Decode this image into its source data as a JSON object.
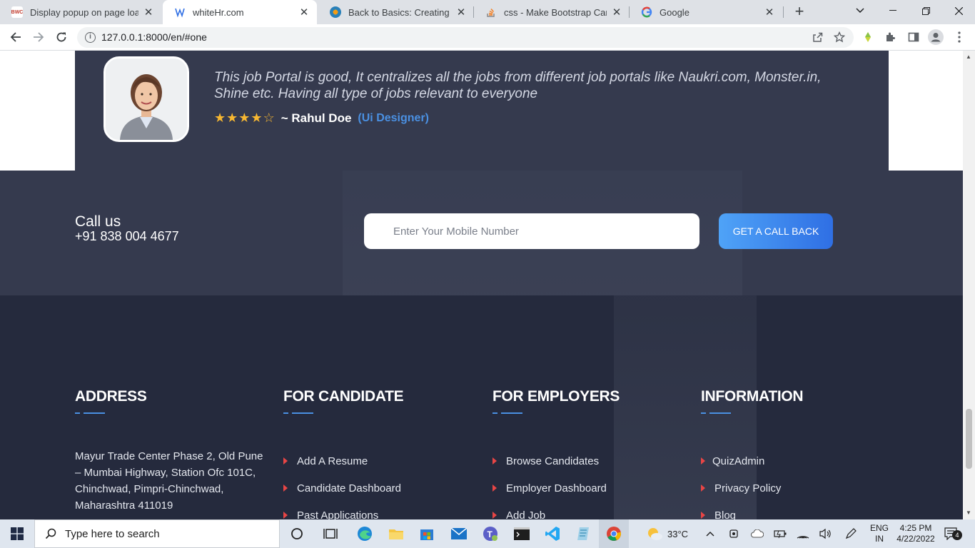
{
  "browser": {
    "tabs": [
      {
        "title": "Display popup on page load",
        "favicon": "bwc-favicon"
      },
      {
        "title": "whiteHr.com",
        "favicon": "whitehr-favicon"
      },
      {
        "title": "Back to Basics: Creating a clic",
        "favicon": "basics-favicon"
      },
      {
        "title": "css - Make Bootstrap Card En",
        "favicon": "stackoverflow-favicon"
      },
      {
        "title": "Google",
        "favicon": "google-favicon"
      }
    ],
    "active_tab": 1,
    "url": "127.0.0.1:8000/en/#one"
  },
  "testimonial": {
    "quote": "This job Portal is good, It centralizes all the jobs from different job portals like Naukri.com, Monster.in, Shine etc. Having all type of jobs relevant to everyone",
    "rating": 4,
    "rating_max": 5,
    "reviewer": "~ Rahul Doe",
    "role": "(Ui Designer)"
  },
  "callband": {
    "title": "Call us",
    "phone": "+91 838 004 4677",
    "input_placeholder": "Enter Your Mobile Number",
    "button_label": "GET A CALL BACK"
  },
  "footer": {
    "address": {
      "heading": "ADDRESS",
      "text": "Mayur Trade Center Phase 2, Old Pune – Mumbai Highway, Station Ofc 101C, Chinchwad, Pimpri-Chinchwad, Maharashtra 411019"
    },
    "candidate": {
      "heading": "FOR CANDIDATE",
      "links": [
        "Add A Resume",
        "Candidate Dashboard",
        "Past Applications"
      ]
    },
    "employers": {
      "heading": "FOR EMPLOYERS",
      "links": [
        "Browse Candidates",
        "Employer Dashboard",
        "Add Job"
      ]
    },
    "information": {
      "heading": "INFORMATION",
      "links": [
        "QuizAdmin",
        "Privacy Policy",
        "Blog"
      ]
    }
  },
  "taskbar": {
    "search_placeholder": "Type here to search",
    "weather": "33°C",
    "lang_line1": "ENG",
    "lang_line2": "IN",
    "time": "4:25 PM",
    "date": "4/22/2022",
    "notifications": "4"
  },
  "colors": {
    "accent": "#4a90e2",
    "star": "#f7b731",
    "footer_bg": "#252a3d",
    "band_bg": "#353a4e",
    "caret": "#e84545"
  }
}
